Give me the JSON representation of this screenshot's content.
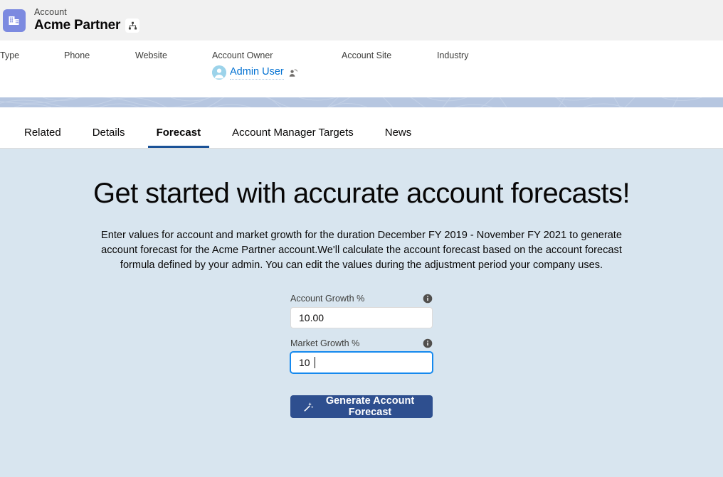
{
  "record_header": {
    "object_name": "Account",
    "record_name": "Acme Partner",
    "icon": "account-building-icon",
    "hierarchy_icon": "account-hierarchy-icon",
    "icon_color": "#7c8ae0"
  },
  "highlights": {
    "fields": [
      {
        "label": "Type",
        "value": ""
      },
      {
        "label": "Phone",
        "value": ""
      },
      {
        "label": "Website",
        "value": ""
      },
      {
        "label": "Account Owner",
        "value": "Admin User",
        "avatar_icon": "user-avatar-icon",
        "action_icon": "change-owner-icon"
      },
      {
        "label": "Account Site",
        "value": ""
      },
      {
        "label": "Industry",
        "value": ""
      }
    ]
  },
  "tabs": [
    {
      "label": "Related",
      "active": false
    },
    {
      "label": "Details",
      "active": false
    },
    {
      "label": "Forecast",
      "active": true
    },
    {
      "label": "Account Manager Targets",
      "active": false
    },
    {
      "label": "News",
      "active": false
    }
  ],
  "main": {
    "title": "Get started with accurate account forecasts!",
    "description": "Enter values for account and market growth for the duration December FY 2019 - November FY 2021 to generate account forecast for the Acme Partner account.We'll calculate the account forecast based on the account forecast formula defined by your admin. You can edit the values during the adjustment period your company uses.",
    "form": {
      "fields": [
        {
          "label": "Account Growth %",
          "value": "10.00",
          "placeholder": "",
          "info_icon": "info-icon",
          "focused": false
        },
        {
          "label": "Market Growth %",
          "value": "10",
          "placeholder": "",
          "info_icon": "info-icon",
          "focused": true
        }
      ],
      "submit_label": "Generate Account Forecast",
      "submit_icon": "magic-wand-icon"
    }
  },
  "colors": {
    "header_bg": "#f1f1f1",
    "panel_bg": "#d8e5ef",
    "accent_blue": "#1b5297",
    "link_blue": "#0070d2",
    "button_bg": "#2e4f8f",
    "band_bg": "#b6c6e0"
  }
}
